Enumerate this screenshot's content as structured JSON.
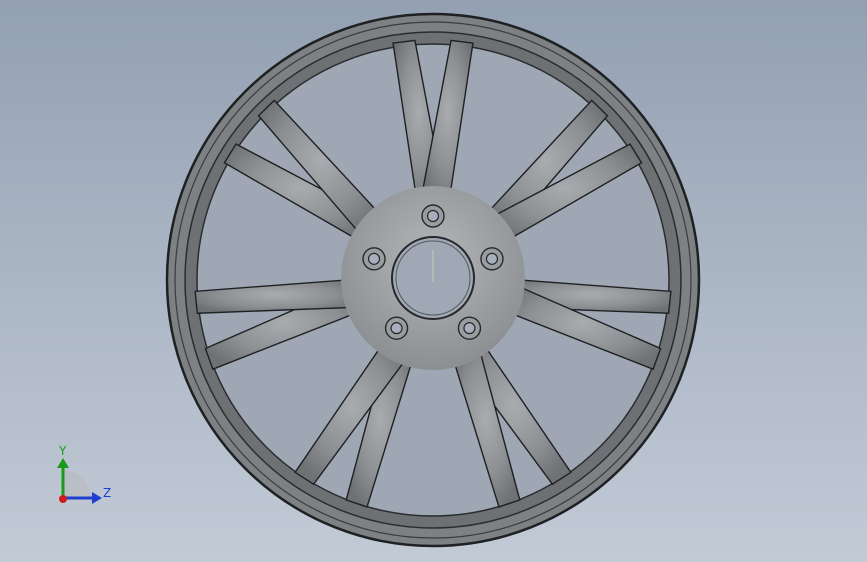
{
  "viewport": {
    "background_top": "#93a0b1",
    "background_bottom": "#c2cad6"
  },
  "wheel": {
    "model": "alloy-wheel",
    "spoke_pairs": 7,
    "lug_holes": 5,
    "metal_color": "#8b8e91",
    "edge_color": "#1e2022"
  },
  "triad": {
    "y_label": "Y",
    "z_label": "Z",
    "y_color": "#1a9a1a",
    "z_color": "#1f3fd0",
    "x_color": "#d01c1c"
  }
}
